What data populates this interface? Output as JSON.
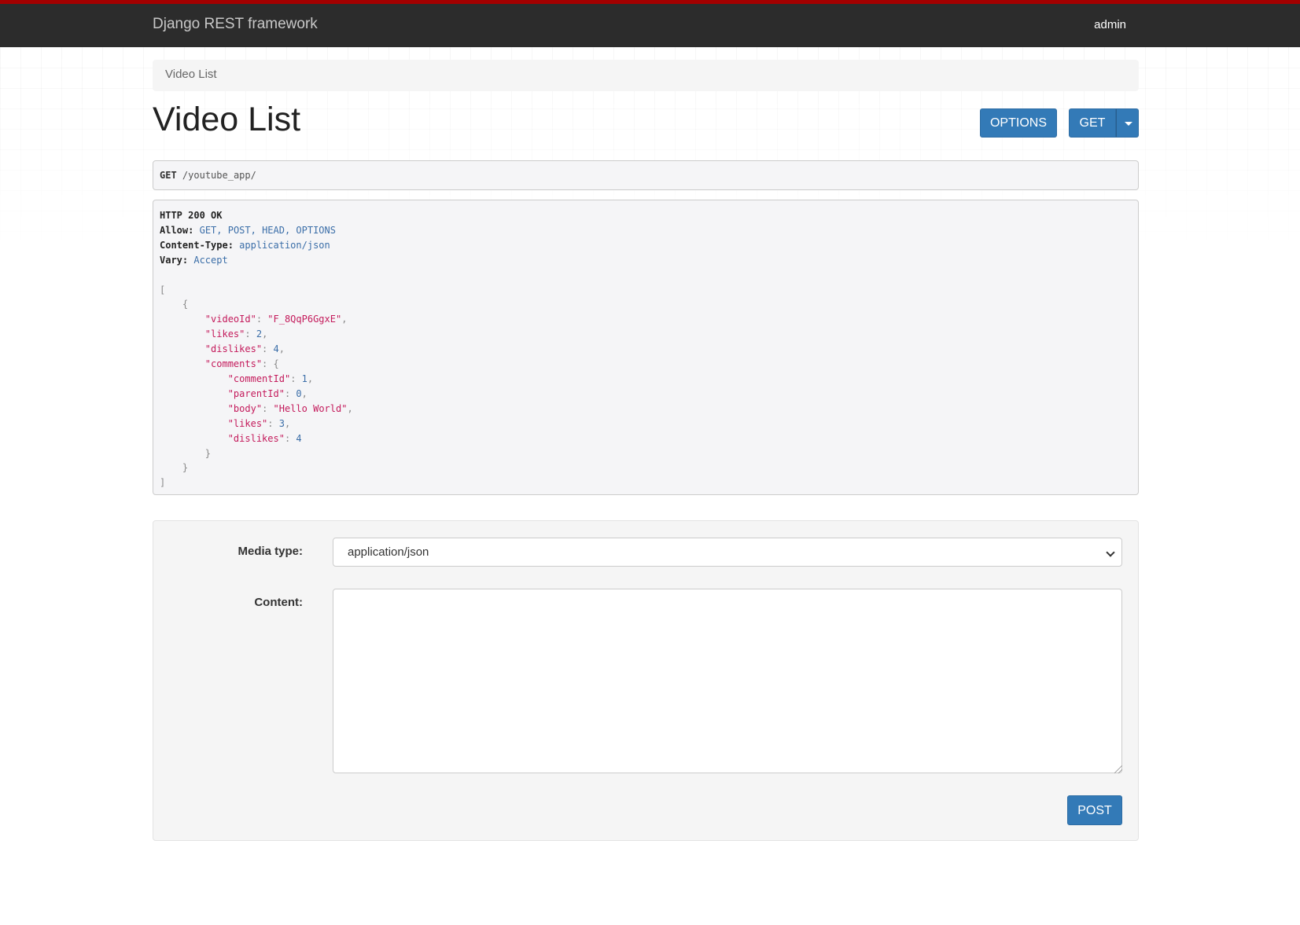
{
  "navbar": {
    "brand": "Django REST framework",
    "user": "admin"
  },
  "breadcrumb": "Video List",
  "page_title": "Video List",
  "buttons": {
    "options": "OPTIONS",
    "get": "GET",
    "post": "POST"
  },
  "request": {
    "method": "GET",
    "path": "/youtube_app/"
  },
  "response": {
    "status": "HTTP 200 OK",
    "headers": [
      {
        "name": "Allow:",
        "value": "GET, POST, HEAD, OPTIONS"
      },
      {
        "name": "Content-Type:",
        "value": "application/json"
      },
      {
        "name": "Vary:",
        "value": "Accept"
      }
    ],
    "body": {
      "videoId_key": "\"videoId\"",
      "videoId_val": "\"F_8QqP6GgxE\"",
      "likes_key": "\"likes\"",
      "likes_val": "2",
      "dislikes_key": "\"dislikes\"",
      "dislikes_val": "4",
      "comments_key": "\"comments\"",
      "commentId_key": "\"commentId\"",
      "commentId_val": "1",
      "parentId_key": "\"parentId\"",
      "parentId_val": "0",
      "body_key": "\"body\"",
      "body_val": "\"Hello World\"",
      "c_likes_key": "\"likes\"",
      "c_likes_val": "3",
      "c_dislikes_key": "\"dislikes\"",
      "c_dislikes_val": "4"
    }
  },
  "form": {
    "media_type_label": "Media type:",
    "media_type_value": "application/json",
    "content_label": "Content:",
    "content_value": ""
  },
  "colors": {
    "navbar_bg": "#2c2c2c",
    "navbar_accent": "#a30000",
    "button_primary": "#337ab7",
    "json_key": "#c41a5b",
    "json_number": "#3b6ea8"
  }
}
